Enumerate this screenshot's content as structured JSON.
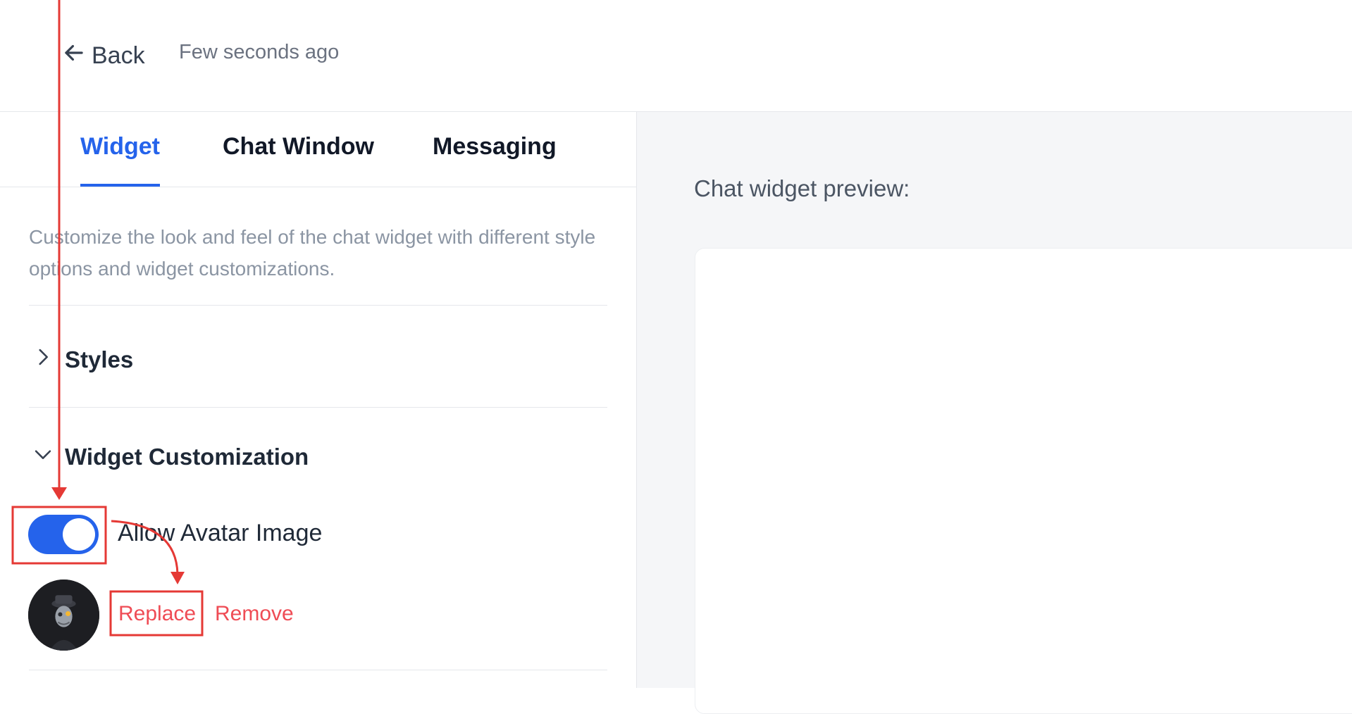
{
  "header": {
    "back_label": "Back",
    "saved_status": "Few seconds ago"
  },
  "tabs": [
    {
      "label": "Widget",
      "active": true
    },
    {
      "label": "Chat Window",
      "active": false
    },
    {
      "label": "Messaging",
      "active": false
    }
  ],
  "description": "Customize the look and feel of the chat widget with different style options and widget customizations.",
  "sections": {
    "styles": {
      "label": "Styles",
      "expanded": false
    },
    "widget_customization": {
      "label": "Widget Customization",
      "expanded": true
    }
  },
  "avatar_toggle": {
    "label": "Allow Avatar Image",
    "enabled": true
  },
  "avatar_actions": {
    "replace": "Replace",
    "remove": "Remove"
  },
  "preview": {
    "title": "Chat widget preview:"
  },
  "colors": {
    "accent": "#2563eb",
    "link_danger": "#ef4c55",
    "annotation": "#e53935"
  },
  "icons": [
    "arrow-left-icon",
    "chevron-right-icon",
    "chevron-down-icon",
    "avatar-image"
  ]
}
